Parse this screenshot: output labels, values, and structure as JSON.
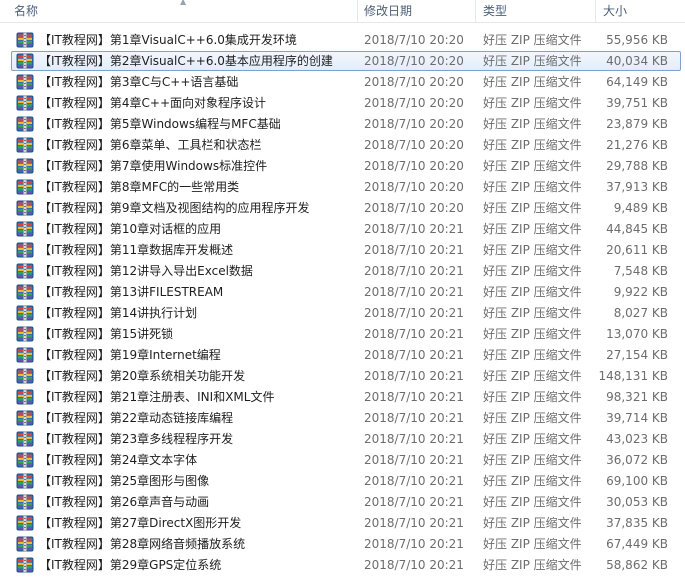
{
  "columns": {
    "name": "名称",
    "date": "修改日期",
    "type": "类型",
    "size": "大小"
  },
  "selected_index": 1,
  "files": [
    {
      "name": "【IT教程网】第1章VisualC++6.0集成开发环境",
      "date": "2018/7/10 20:20",
      "type": "好压 ZIP 压缩文件",
      "size": "55,956 KB"
    },
    {
      "name": "【IT教程网】第2章VisualC++6.0基本应用程序的创建",
      "date": "2018/7/10 20:20",
      "type": "好压 ZIP 压缩文件",
      "size": "40,034 KB"
    },
    {
      "name": "【IT教程网】第3章C与C++语言基础",
      "date": "2018/7/10 20:20",
      "type": "好压 ZIP 压缩文件",
      "size": "64,149 KB"
    },
    {
      "name": "【IT教程网】第4章C++面向对象程序设计",
      "date": "2018/7/10 20:20",
      "type": "好压 ZIP 压缩文件",
      "size": "39,751 KB"
    },
    {
      "name": "【IT教程网】第5章Windows编程与MFC基础",
      "date": "2018/7/10 20:20",
      "type": "好压 ZIP 压缩文件",
      "size": "23,879 KB"
    },
    {
      "name": "【IT教程网】第6章菜单、工具栏和状态栏",
      "date": "2018/7/10 20:20",
      "type": "好压 ZIP 压缩文件",
      "size": "21,276 KB"
    },
    {
      "name": "【IT教程网】第7章使用Windows标准控件",
      "date": "2018/7/10 20:20",
      "type": "好压 ZIP 压缩文件",
      "size": "29,788 KB"
    },
    {
      "name": "【IT教程网】第8章MFC的一些常用类",
      "date": "2018/7/10 20:20",
      "type": "好压 ZIP 压缩文件",
      "size": "37,913 KB"
    },
    {
      "name": "【IT教程网】第9章文档及视图结构的应用程序开发",
      "date": "2018/7/10 20:20",
      "type": "好压 ZIP 压缩文件",
      "size": "9,489 KB"
    },
    {
      "name": "【IT教程网】第10章对话框的应用",
      "date": "2018/7/10 20:21",
      "type": "好压 ZIP 压缩文件",
      "size": "44,845 KB"
    },
    {
      "name": "【IT教程网】第11章数据库开发概述",
      "date": "2018/7/10 20:21",
      "type": "好压 ZIP 压缩文件",
      "size": "20,611 KB"
    },
    {
      "name": "【IT教程网】第12讲导入导出Excel数据",
      "date": "2018/7/10 20:21",
      "type": "好压 ZIP 压缩文件",
      "size": "7,548 KB"
    },
    {
      "name": "【IT教程网】第13讲FILESTREAM",
      "date": "2018/7/10 20:21",
      "type": "好压 ZIP 压缩文件",
      "size": "9,922 KB"
    },
    {
      "name": "【IT教程网】第14讲执行计划",
      "date": "2018/7/10 20:21",
      "type": "好压 ZIP 压缩文件",
      "size": "8,027 KB"
    },
    {
      "name": "【IT教程网】第15讲死锁",
      "date": "2018/7/10 20:21",
      "type": "好压 ZIP 压缩文件",
      "size": "13,070 KB"
    },
    {
      "name": "【IT教程网】第19章Internet编程",
      "date": "2018/7/10 20:21",
      "type": "好压 ZIP 压缩文件",
      "size": "27,154 KB"
    },
    {
      "name": "【IT教程网】第20章系统相关功能开发",
      "date": "2018/7/10 20:21",
      "type": "好压 ZIP 压缩文件",
      "size": "148,131 KB"
    },
    {
      "name": "【IT教程网】第21章注册表、INI和XML文件",
      "date": "2018/7/10 20:21",
      "type": "好压 ZIP 压缩文件",
      "size": "98,321 KB"
    },
    {
      "name": "【IT教程网】第22章动态链接库编程",
      "date": "2018/7/10 20:21",
      "type": "好压 ZIP 压缩文件",
      "size": "39,714 KB"
    },
    {
      "name": "【IT教程网】第23章多线程程序开发",
      "date": "2018/7/10 20:21",
      "type": "好压 ZIP 压缩文件",
      "size": "43,023 KB"
    },
    {
      "name": "【IT教程网】第24章文本字体",
      "date": "2018/7/10 20:21",
      "type": "好压 ZIP 压缩文件",
      "size": "36,072 KB"
    },
    {
      "name": "【IT教程网】第25章图形与图像",
      "date": "2018/7/10 20:21",
      "type": "好压 ZIP 压缩文件",
      "size": "69,100 KB"
    },
    {
      "name": "【IT教程网】第26章声音与动画",
      "date": "2018/7/10 20:21",
      "type": "好压 ZIP 压缩文件",
      "size": "30,053 KB"
    },
    {
      "name": "【IT教程网】第27章DirectX图形开发",
      "date": "2018/7/10 20:21",
      "type": "好压 ZIP 压缩文件",
      "size": "37,835 KB"
    },
    {
      "name": "【IT教程网】第28章网络音频播放系统",
      "date": "2018/7/10 20:21",
      "type": "好压 ZIP 压缩文件",
      "size": "67,449 KB"
    },
    {
      "name": "【IT教程网】第29章GPS定位系统",
      "date": "2018/7/10 20:21",
      "type": "好压 ZIP 压缩文件",
      "size": "58,862 KB"
    }
  ],
  "icon": "zip-archive-icon",
  "colors": {
    "selection_border": "#7da2ce",
    "selection_fill": "#e8f0fb",
    "header_text": "#4c607a",
    "secondary_text": "#6d6d6d"
  }
}
